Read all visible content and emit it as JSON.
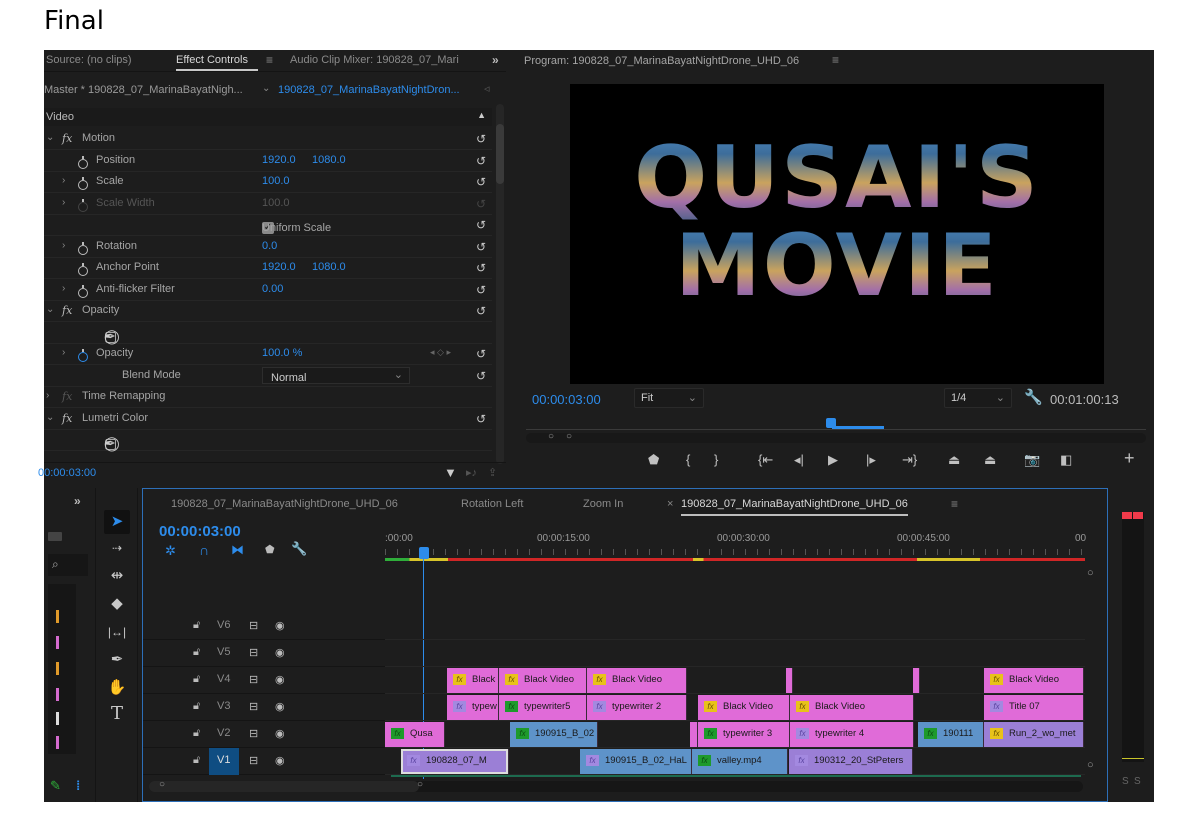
{
  "heading": "Final",
  "effect_panel": {
    "tabs": [
      "Source: (no clips)",
      "Effect Controls",
      "Audio Clip Mixer: 190828_07_Mari"
    ],
    "tab_menu_icon": "hamburger-icon",
    "overflow_icon": "double-chevron-icon",
    "master_label": "Master * 190828_07_MarinaBayatNigh...",
    "clip_label": "190828_07_MarinaBayatNightDron...",
    "section": "Video",
    "rows": [
      {
        "type": "effect",
        "label": "Motion"
      },
      {
        "type": "prop",
        "label": "Position",
        "v1": "1920.0",
        "v2": "1080.0"
      },
      {
        "type": "prop",
        "label": "Scale",
        "v1": "100.0"
      },
      {
        "type": "prop-disabled",
        "label": "Scale Width",
        "v1": "100.0"
      },
      {
        "type": "checkbox",
        "label": "Uniform Scale",
        "checked": true
      },
      {
        "type": "prop",
        "label": "Rotation",
        "v1": "0.0"
      },
      {
        "type": "prop",
        "label": "Anchor Point",
        "v1": "1920.0",
        "v2": "1080.0"
      },
      {
        "type": "prop",
        "label": "Anti-flicker Filter",
        "v1": "0.00"
      },
      {
        "type": "effect",
        "label": "Opacity"
      },
      {
        "type": "masks"
      },
      {
        "type": "prop-anim",
        "label": "Opacity",
        "v1": "100.0 %"
      },
      {
        "type": "select",
        "label": "Blend Mode",
        "value": "Normal"
      },
      {
        "type": "effect-disabled",
        "label": "Time Remapping"
      },
      {
        "type": "effect",
        "label": "Lumetri Color"
      },
      {
        "type": "masks"
      }
    ],
    "timecode": "00:00:03:00"
  },
  "program_monitor": {
    "title": "Program: 190828_07_MarinaBayatNightDrone_UHD_06",
    "frame_text_line1": "QUSAI'S",
    "frame_text_line2": "MOVIE",
    "timecode": "00:00:03:00",
    "zoom": "Fit",
    "resolution": "1/4",
    "duration": "00:01:00:13",
    "controls": [
      "marker",
      "mark-in",
      "mark-out",
      "go-to-in",
      "step-back",
      "play",
      "step-forward",
      "go-to-out",
      "lift",
      "extract",
      "export-frame",
      "comparison-view",
      "add"
    ]
  },
  "timeline": {
    "tabs": [
      "190828_07_MarinaBayatNightDrone_UHD_06",
      "Rotation Left",
      "Zoom In",
      "190828_07_MarinaBayatNightDrone_UHD_06"
    ],
    "active_tab": 3,
    "timecode": "00:00:03:00",
    "ruler": [
      ":00:00",
      "00:00:15:00",
      "00:00:30:00",
      "00:00:45:00",
      "00"
    ],
    "tracks": [
      {
        "name": "V6",
        "clips": []
      },
      {
        "name": "V5",
        "clips": []
      },
      {
        "name": "V4",
        "clips": [
          {
            "label": "Black",
            "fx": "yellow",
            "color": "pink"
          },
          {
            "label": "Black Video",
            "fx": "yellow",
            "color": "pink"
          },
          {
            "label": "Black Video",
            "fx": "yellow",
            "color": "pink"
          },
          {
            "label": "",
            "fx": "",
            "color": "pink"
          },
          {
            "label": "",
            "fx": "",
            "color": "pink"
          },
          {
            "label": "Black Video",
            "fx": "yellow",
            "color": "pink"
          }
        ]
      },
      {
        "name": "V3",
        "clips": [
          {
            "label": "typew",
            "fx": "purple",
            "color": "pink"
          },
          {
            "label": "typewriter5",
            "fx": "green",
            "color": "pink"
          },
          {
            "label": "typewriter 2",
            "fx": "purple",
            "color": "pink"
          },
          {
            "label": "Black Video",
            "fx": "yellow",
            "color": "pink"
          },
          {
            "label": "Black Video",
            "fx": "yellow",
            "color": "pink"
          },
          {
            "label": "Title 07",
            "fx": "purple",
            "color": "pink"
          }
        ]
      },
      {
        "name": "V2",
        "clips": [
          {
            "label": "Qusa",
            "fx": "green",
            "color": "pink"
          },
          {
            "label": "190915_B_02",
            "fx": "green",
            "color": "blue"
          },
          {
            "label": "",
            "fx": "",
            "color": "pink"
          },
          {
            "label": "typewriter 3",
            "fx": "green",
            "color": "pink"
          },
          {
            "label": "typewriter 4",
            "fx": "purple",
            "color": "pink"
          },
          {
            "label": "190111",
            "fx": "green",
            "color": "blue"
          },
          {
            "label": "Run_2_wo_met",
            "fx": "yellow",
            "color": "purple"
          }
        ]
      },
      {
        "name": "V1",
        "clips": [
          {
            "label": "190828_07_M",
            "fx": "purple",
            "color": "purple"
          },
          {
            "label": "190915_B_02_HaL",
            "fx": "purple",
            "color": "blue"
          },
          {
            "label": "valley.mp4",
            "fx": "green",
            "color": "blue"
          },
          {
            "label": "190312_20_StPeters",
            "fx": "purple",
            "color": "purple"
          }
        ]
      }
    ]
  },
  "audio_meter": {
    "labels": [
      "S",
      "S"
    ]
  },
  "colors": {
    "accent": "#2d8ceb",
    "clip_pink": "#e06bd8",
    "clip_blue": "#5e93c9",
    "clip_purple": "#9b7fd6"
  }
}
